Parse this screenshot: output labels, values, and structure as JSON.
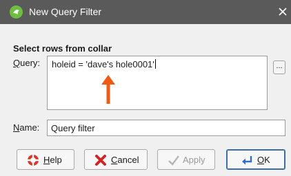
{
  "window": {
    "title": "New Query Filter",
    "app_icon": "leapfrog-icon",
    "close_icon": "close-icon"
  },
  "filter": {
    "section_heading": "Select rows from collar",
    "query_label_mnemonic": "Q",
    "query_label_rest": "uery:",
    "query_value": "holeid = 'dave's hole0001'",
    "ellipsis_label": "...",
    "name_label_mnemonic": "N",
    "name_label_rest": "ame:",
    "name_value": "Query filter"
  },
  "annotation": {
    "arrow_color": "#f05a14"
  },
  "buttons": {
    "help": {
      "mnemonic": "H",
      "rest": "elp"
    },
    "cancel": {
      "mnemonic": "C",
      "rest": "ancel"
    },
    "apply": {
      "label": "Apply"
    },
    "ok": {
      "mnemonic": "O",
      "rest": "K"
    }
  }
}
